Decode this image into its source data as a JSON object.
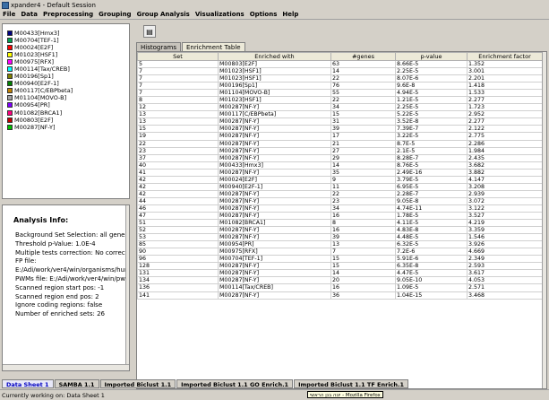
{
  "window": {
    "title": "xpander4 - Default Session"
  },
  "menu": [
    "File",
    "Data",
    "Preprocessing",
    "Grouping",
    "Group Analysis",
    "Visualizations",
    "Options",
    "Help"
  ],
  "legend": [
    {
      "label": "M00433[Hmx3]",
      "color": "#000080"
    },
    {
      "label": "M00704[TEF-1]",
      "color": "#00a050"
    },
    {
      "label": "M00024[E2F]",
      "color": "#ff0000"
    },
    {
      "label": "M01023[HSF1]",
      "color": "#ffff00"
    },
    {
      "label": "M00975[RFX]",
      "color": "#ff00ff"
    },
    {
      "label": "M00114[Tax/CREB]",
      "color": "#00ffff"
    },
    {
      "label": "M00196[Sp1]",
      "color": "#808000"
    },
    {
      "label": "M00940[E2F-1]",
      "color": "#008000"
    },
    {
      "label": "M00117[C/EBPbeta]",
      "color": "#c08000"
    },
    {
      "label": "M01104[MOVO-B]",
      "color": "#a0a0a0"
    },
    {
      "label": "M00954[PR]",
      "color": "#8000ff"
    },
    {
      "label": "M01082[BRCA1]",
      "color": "#ff0080"
    },
    {
      "label": "M00803[E2F]",
      "color": "#c00000"
    },
    {
      "label": "M00287[NF-Y]",
      "color": "#00c000"
    }
  ],
  "analysis": {
    "title": "Analysis Info:",
    "lines": [
      "Background Set Selection: all genes",
      "Threshold p-Value: 1.0E-4",
      "Multiple tests correction: No correctio",
      "FP file:",
      "E:/Adi/work/ver4/win/organisms/hum",
      "PWMs file: E:/Adi/work/ver4/win/pwm",
      "Scanned region start pos:          -1",
      "Scanned region end pos:            2",
      "Ignore coding regions: false",
      "Number of enriched sets: 26"
    ]
  },
  "tabs": [
    "Histograms",
    "Enrichment Table"
  ],
  "table": {
    "columns": [
      "Set",
      "Enriched with",
      "#genes",
      "p-value",
      "Enrichment factor"
    ],
    "rows": [
      [
        "5",
        "M00803[E2F]",
        "63",
        "8.66E-5",
        "1.352"
      ],
      [
        "7",
        "M01023[HSF1]",
        "14",
        "2.25E-5",
        "3.001"
      ],
      [
        "7",
        "M01023[HSF1]",
        "22",
        "8.07E-6",
        "2.201"
      ],
      [
        "7",
        "M00196[Sp1]",
        "76",
        "9.6E-8",
        "1.418"
      ],
      [
        "7",
        "M01104[MOVO-B]",
        "55",
        "4.94E-5",
        "1.533"
      ],
      [
        "8",
        "M01023[HSF1]",
        "22",
        "1.21E-5",
        "2.277"
      ],
      [
        "12",
        "M00287[NF-Y]",
        "34",
        "2.25E-5",
        "1.723"
      ],
      [
        "13",
        "M00117[C/EBPbeta]",
        "15",
        "5.22E-5",
        "2.952"
      ],
      [
        "13",
        "M00287[NF-Y]",
        "31",
        "3.52E-8",
        "2.277"
      ],
      [
        "15",
        "M00287[NF-Y]",
        "39",
        "7.39E-7",
        "2.122"
      ],
      [
        "19",
        "M00287[NF-Y]",
        "17",
        "3.22E-5",
        "2.775"
      ],
      [
        "22",
        "M00287[NF-Y]",
        "21",
        "8.7E-5",
        "2.286"
      ],
      [
        "23",
        "M00287[NF-Y]",
        "27",
        "2.1E-5",
        "1.984"
      ],
      [
        "37",
        "M00287[NF-Y]",
        "29",
        "8.28E-7",
        "2.435"
      ],
      [
        "40",
        "M00433[Hmx3]",
        "14",
        "8.76E-5",
        "3.682"
      ],
      [
        "41",
        "M00287[NF-Y]",
        "35",
        "2.49E-16",
        "3.882"
      ],
      [
        "42",
        "M00024[E2F]",
        "9",
        "3.79E-5",
        "4.147"
      ],
      [
        "42",
        "M00940[E2F-1]",
        "11",
        "6.95E-5",
        "3.208"
      ],
      [
        "42",
        "M00287[NF-Y]",
        "22",
        "2.28E-7",
        "2.939"
      ],
      [
        "44",
        "M00287[NF-Y]",
        "23",
        "9.05E-8",
        "3.072"
      ],
      [
        "46",
        "M00287[NF-Y]",
        "34",
        "4.74E-11",
        "3.122"
      ],
      [
        "47",
        "M00287[NF-Y]",
        "16",
        "1.78E-5",
        "3.527"
      ],
      [
        "51",
        "M01082[BRCA1]",
        "8",
        "4.11E-5",
        "4.219"
      ],
      [
        "52",
        "M00287[NF-Y]",
        "16",
        "4.83E-8",
        "3.359"
      ],
      [
        "53",
        "M00287[NF-Y]",
        "39",
        "4.48E-5",
        "1.546"
      ],
      [
        "85",
        "M00954[PR]",
        "13",
        "6.32E-5",
        "3.926"
      ],
      [
        "90",
        "M00975[RFX]",
        "7",
        "7.2E-6",
        "4.669"
      ],
      [
        "96",
        "M00704[TEF-1]",
        "15",
        "5.91E-6",
        "2.349"
      ],
      [
        "128",
        "M00287[NF-Y]",
        "15",
        "6.35E-8",
        "2.593"
      ],
      [
        "131",
        "M00287[NF-Y]",
        "14",
        "4.47E-5",
        "3.617"
      ],
      [
        "134",
        "M00287[NF-Y]",
        "20",
        "9.05E-10",
        "4.053"
      ],
      [
        "136",
        "M00114[Tax/CREB]",
        "16",
        "1.09E-5",
        "2.571"
      ],
      [
        "141",
        "M00287[NF-Y]",
        "36",
        "1.04E-15",
        "3.468"
      ]
    ]
  },
  "bottom_tabs": [
    "Data Sheet 1",
    "SAMBA 1.1",
    "Imported Biclust 1.1",
    "Imported Biclust 1.1 GO Enrich.1",
    "Imported Biclust 1.1 TF Enrich.1"
  ],
  "tooltip": "יונה בנן הראשי - Mozilla Firefox",
  "status": "Currently working on: Data Sheet 1"
}
